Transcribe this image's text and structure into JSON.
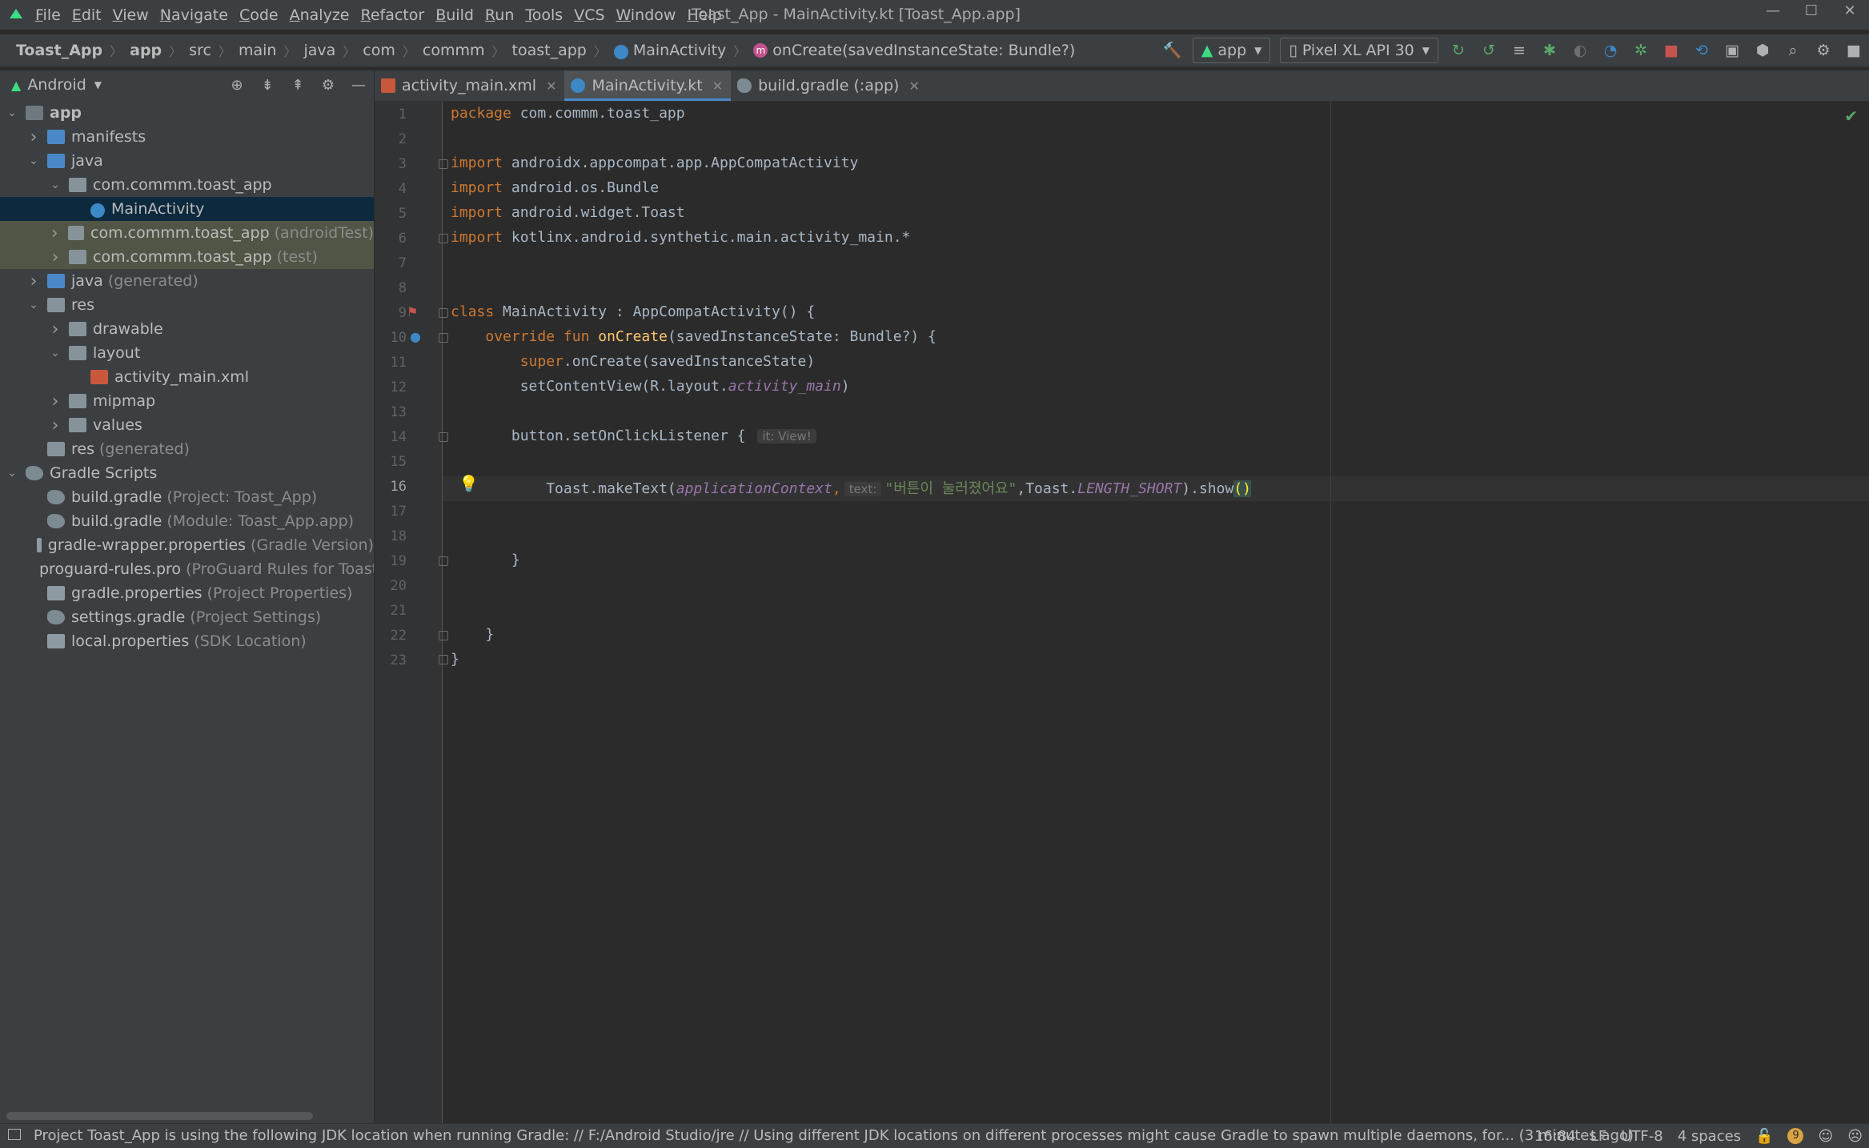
{
  "window": {
    "title": "Toast_App - MainActivity.kt [Toast_App.app]",
    "menu": [
      "File",
      "Edit",
      "View",
      "Navigate",
      "Code",
      "Analyze",
      "Refactor",
      "Build",
      "Run",
      "Tools",
      "VCS",
      "Window",
      "Help"
    ],
    "controls": {
      "minimize": "—",
      "maximize": "☐",
      "close": "✕"
    }
  },
  "navbar": {
    "breadcrumb": [
      "Toast_App",
      "app",
      "src",
      "main",
      "java",
      "com",
      "commm",
      "toast_app",
      "MainActivity",
      "onCreate(savedInstanceState: Bundle?)"
    ],
    "run_config": "app",
    "device": "Pixel XL API 30"
  },
  "project_panel": {
    "view_label": "Android",
    "tree": [
      {
        "label": "app",
        "dim": "",
        "depth": 0,
        "arrow": "open",
        "icon": "module",
        "bold": true
      },
      {
        "label": "manifests",
        "dim": "",
        "depth": 1,
        "arrow": "closed",
        "icon": "folder-blue"
      },
      {
        "label": "java",
        "dim": "",
        "depth": 1,
        "arrow": "open",
        "icon": "folder-blue"
      },
      {
        "label": "com.commm.toast_app",
        "dim": "",
        "depth": 2,
        "arrow": "open",
        "icon": "package"
      },
      {
        "label": "MainActivity",
        "dim": "",
        "depth": 3,
        "arrow": "none",
        "icon": "kotlin-class",
        "state": "selected"
      },
      {
        "label": "com.commm.toast_app",
        "dim": "(androidTest)",
        "depth": 2,
        "arrow": "closed",
        "icon": "package",
        "state": "marked"
      },
      {
        "label": "com.commm.toast_app",
        "dim": "(test)",
        "depth": 2,
        "arrow": "closed",
        "icon": "package",
        "state": "marked"
      },
      {
        "label": "java",
        "dim": "(generated)",
        "depth": 1,
        "arrow": "closed",
        "icon": "folder-gen"
      },
      {
        "label": "res",
        "dim": "",
        "depth": 1,
        "arrow": "open",
        "icon": "folder-res"
      },
      {
        "label": "drawable",
        "dim": "",
        "depth": 2,
        "arrow": "closed",
        "icon": "package"
      },
      {
        "label": "layout",
        "dim": "",
        "depth": 2,
        "arrow": "open",
        "icon": "package"
      },
      {
        "label": "activity_main.xml",
        "dim": "",
        "depth": 3,
        "arrow": "none",
        "icon": "xml"
      },
      {
        "label": "mipmap",
        "dim": "",
        "depth": 2,
        "arrow": "closed",
        "icon": "package"
      },
      {
        "label": "values",
        "dim": "",
        "depth": 2,
        "arrow": "closed",
        "icon": "package"
      },
      {
        "label": "res",
        "dim": "(generated)",
        "depth": 1,
        "arrow": "none",
        "icon": "folder-res"
      },
      {
        "label": "Gradle Scripts",
        "dim": "",
        "depth": 0,
        "arrow": "open",
        "icon": "gradle"
      },
      {
        "label": "build.gradle",
        "dim": "(Project: Toast_App)",
        "depth": 1,
        "arrow": "none",
        "icon": "gradle"
      },
      {
        "label": "build.gradle",
        "dim": "(Module: Toast_App.app)",
        "depth": 1,
        "arrow": "none",
        "icon": "gradle"
      },
      {
        "label": "gradle-wrapper.properties",
        "dim": "(Gradle Version)",
        "depth": 1,
        "arrow": "none",
        "icon": "properties"
      },
      {
        "label": "proguard-rules.pro",
        "dim": "(ProGuard Rules for Toast",
        "depth": 1,
        "arrow": "none",
        "icon": "properties"
      },
      {
        "label": "gradle.properties",
        "dim": "(Project Properties)",
        "depth": 1,
        "arrow": "none",
        "icon": "properties"
      },
      {
        "label": "settings.gradle",
        "dim": "(Project Settings)",
        "depth": 1,
        "arrow": "none",
        "icon": "gradle"
      },
      {
        "label": "local.properties",
        "dim": "(SDK Location)",
        "depth": 1,
        "arrow": "none",
        "icon": "properties"
      }
    ]
  },
  "editor": {
    "tabs": [
      {
        "label": "activity_main.xml",
        "icon": "xml",
        "active": false
      },
      {
        "label": "MainActivity.kt",
        "icon": "kotlin-class",
        "active": true
      },
      {
        "label": "build.gradle (:app)",
        "icon": "gradle",
        "active": false
      }
    ],
    "line_numbers": [
      "1",
      "2",
      "3",
      "4",
      "5",
      "6",
      "7",
      "8",
      "9",
      "10",
      "11",
      "12",
      "13",
      "14",
      "15",
      "16",
      "17",
      "18",
      "19",
      "20",
      "21",
      "22",
      "23"
    ],
    "current_line": 16,
    "code": {
      "l1_kw": "package",
      "l1_rest": " com.commm.toast_app",
      "l3_kw": "import",
      "l3_rest": " androidx.appcompat.app.AppCompatActivity",
      "l4_kw": "import",
      "l4_rest": " android.os.Bundle",
      "l5_kw": "import",
      "l5_rest": " android.widget.Toast",
      "l6_kw": "import",
      "l6_rest": " kotlinx.android.synthetic.main.activity_main.*",
      "l9_kw": "class",
      "l9_rest": " MainActivity : AppCompatActivity() {",
      "l10_indent": "    ",
      "l10_kw": "override fun",
      "l10_fn": "onCreate",
      "l10_rest": "(savedInstanceState: Bundle?) {",
      "l11_indent": "        ",
      "l11_kw": "super",
      "l11_rest": ".onCreate(savedInstanceState)",
      "l12_indent": "        ",
      "l12_rest": "setContentView(R.layout.",
      "l12_it": "activity_main",
      "l12_end": ")",
      "l14_indent": "       ",
      "l14_rest": "button.setOnClickListener {",
      "l14_hint": "it: View!",
      "l16_indent": "           ",
      "l16_a": "Toast.makeText(",
      "l16_it": "applicationContext",
      "l16_comma": ",",
      "l16_hint": "text:",
      "l16_str": "\"버튼이 눌러졌어요\"",
      "l16_b": ",Toast.",
      "l16_it2": "LENGTH_SHORT",
      "l16_c": ").show",
      "l16_d": "()",
      "l19_indent": "       ",
      "l19_rest": "}",
      "l22_indent": "    ",
      "l22_rest": "}",
      "l23_rest": "}"
    }
  },
  "statusbar": {
    "message": "Project Toast_App is using the following JDK location when running Gradle: // F:/Android Studio/jre // Using different JDK locations on different processes might cause Gradle to spawn multiple daemons, for... (3 minutes ago)",
    "position": "16:84",
    "line_sep": "LF",
    "encoding": "UTF-8",
    "indent": "4 spaces",
    "notifications": "9"
  }
}
